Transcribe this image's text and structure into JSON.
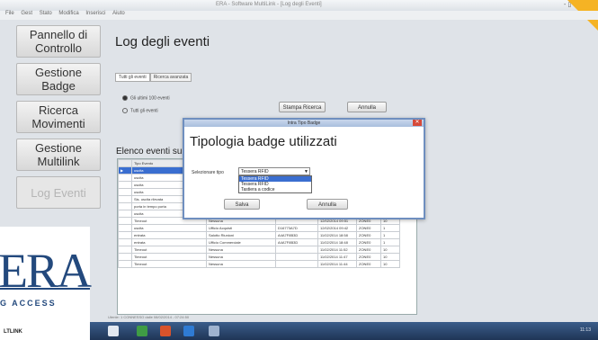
{
  "window": {
    "title": "ERA - Software MultiLink - [Log degli Eventi]",
    "menu": [
      "File",
      "Gest",
      "Stato",
      "Modifica",
      "Inserisci",
      "Aiuto"
    ],
    "controls": "-  ▯  ✕"
  },
  "sidebar": {
    "items": [
      {
        "label": "Pannello di Controllo",
        "enabled": true
      },
      {
        "label": "Gestione Badge",
        "enabled": true
      },
      {
        "label": "Ricerca Movimenti",
        "enabled": true
      },
      {
        "label": "Gestione Multilink",
        "enabled": true
      },
      {
        "label": "Log Eventi",
        "enabled": false
      }
    ]
  },
  "main": {
    "title": "Log degli eventi",
    "tabs": [
      "Tutti gli eventi",
      "Ricerca avanzata"
    ],
    "radios": [
      {
        "label": "Gli ultimi 100 eventi",
        "selected": true
      },
      {
        "label": "Tutti gli eventi",
        "selected": false
      }
    ],
    "buttons": {
      "print": "Stampa Ricerca",
      "cancel": "Annulla"
    },
    "list_title": "Elenco eventi su"
  },
  "grid": {
    "headers": [
      "",
      "Tipo Evento",
      "",
      "",
      "",
      "",
      ""
    ],
    "rows": [
      [
        "▶",
        "uscita",
        "",
        "",
        "",
        "",
        ""
      ],
      [
        "",
        "uscita",
        "",
        "",
        "",
        "",
        ""
      ],
      [
        "",
        "uscita",
        "",
        "",
        "",
        "",
        ""
      ],
      [
        "",
        "uscita",
        "",
        "",
        "",
        "",
        ""
      ],
      [
        "",
        "Sis. uscita rilevata",
        "",
        "",
        "",
        "",
        ""
      ],
      [
        "",
        "porta in tempo porta",
        "",
        "",
        "",
        "",
        ""
      ],
      [
        "",
        "uscita",
        "Ufficio Acquisti",
        "1234596A",
        "12/02/2014 11:51",
        "ZONE0",
        "1"
      ],
      [
        "",
        "Timeout",
        "Nessuna",
        "",
        "12/02/2014 09:51",
        "ZONE0",
        "10"
      ],
      [
        "",
        "uscita",
        "Ufficio Acquisti",
        "D16773A7D",
        "12/02/2014 09:42",
        "ZONE0",
        "1"
      ],
      [
        "",
        "entrata",
        "Salotto Riunioni",
        "A4A7F8B3D",
        "11/02/2014 18:58",
        "ZONE0",
        "1"
      ],
      [
        "",
        "entrata",
        "Ufficio Commerciale",
        "A4A7F8B3D",
        "11/02/2014 18:48",
        "ZONE0",
        "1"
      ],
      [
        "",
        "Timeout",
        "Nessuna",
        "",
        "11/02/2014 11:52",
        "ZONE0",
        "10"
      ],
      [
        "",
        "Timeout",
        "Nessuna",
        "",
        "11/02/2014 11:47",
        "ZONE0",
        "10"
      ],
      [
        "",
        "Timeout",
        "Nessuna",
        "",
        "11/02/2014 11:44",
        "ZONE0",
        "10"
      ]
    ]
  },
  "status": "Utente: 1 CONNESSO dalle 08/02/2014 - 07:24:50",
  "modal": {
    "window_title": "Intra Tipo Badge",
    "heading": "Tipologia badge utilizzati",
    "select_label": "Selezionare tipo",
    "selected": "Tessera RFID",
    "options": [
      "Tessera RFID",
      "Tessera RFID",
      "Tastiera a codice"
    ],
    "highlighted_index": 0,
    "save": "Salva",
    "cancel": "Annulla"
  },
  "logo": {
    "brand": "ERA",
    "tagline": "G ACCESS",
    "product": "LTLINK"
  },
  "taskbar": {
    "clock": "11:13"
  }
}
